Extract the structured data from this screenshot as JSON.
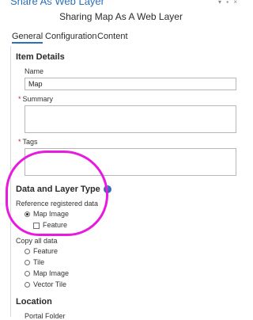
{
  "pane": {
    "title": "Share As Web Layer",
    "controls": "▾ ▪ ×"
  },
  "header": {
    "title": "Sharing Map As A Web Layer"
  },
  "tabs": [
    {
      "label": "General",
      "active": true
    },
    {
      "label": "Configuration",
      "active": false
    },
    {
      "label": "Content",
      "active": false
    }
  ],
  "item_details": {
    "heading": "Item Details",
    "name_label": "Name",
    "name_value": "Map",
    "summary_label": "Summary",
    "summary_value": "",
    "tags_label": "Tags",
    "tags_value": ""
  },
  "data_layer": {
    "heading": "Data and Layer Type",
    "info_icon": "i",
    "reference_label": "Reference registered data",
    "reference_options": [
      {
        "label": "Map Image",
        "type": "radio",
        "selected": true
      },
      {
        "label": "Feature",
        "type": "checkbox",
        "checked": false
      }
    ],
    "copy_label": "Copy all data",
    "copy_options": [
      {
        "label": "Feature",
        "selected": false
      },
      {
        "label": "Tile",
        "selected": false
      },
      {
        "label": "Map Image",
        "selected": false
      },
      {
        "label": "Vector Tile",
        "selected": false
      }
    ]
  },
  "location": {
    "heading": "Location",
    "portal_folder_label": "Portal Folder"
  },
  "colors": {
    "accent": "#2e6fba",
    "annotation": "#e81ae0",
    "required": "#c62828"
  }
}
